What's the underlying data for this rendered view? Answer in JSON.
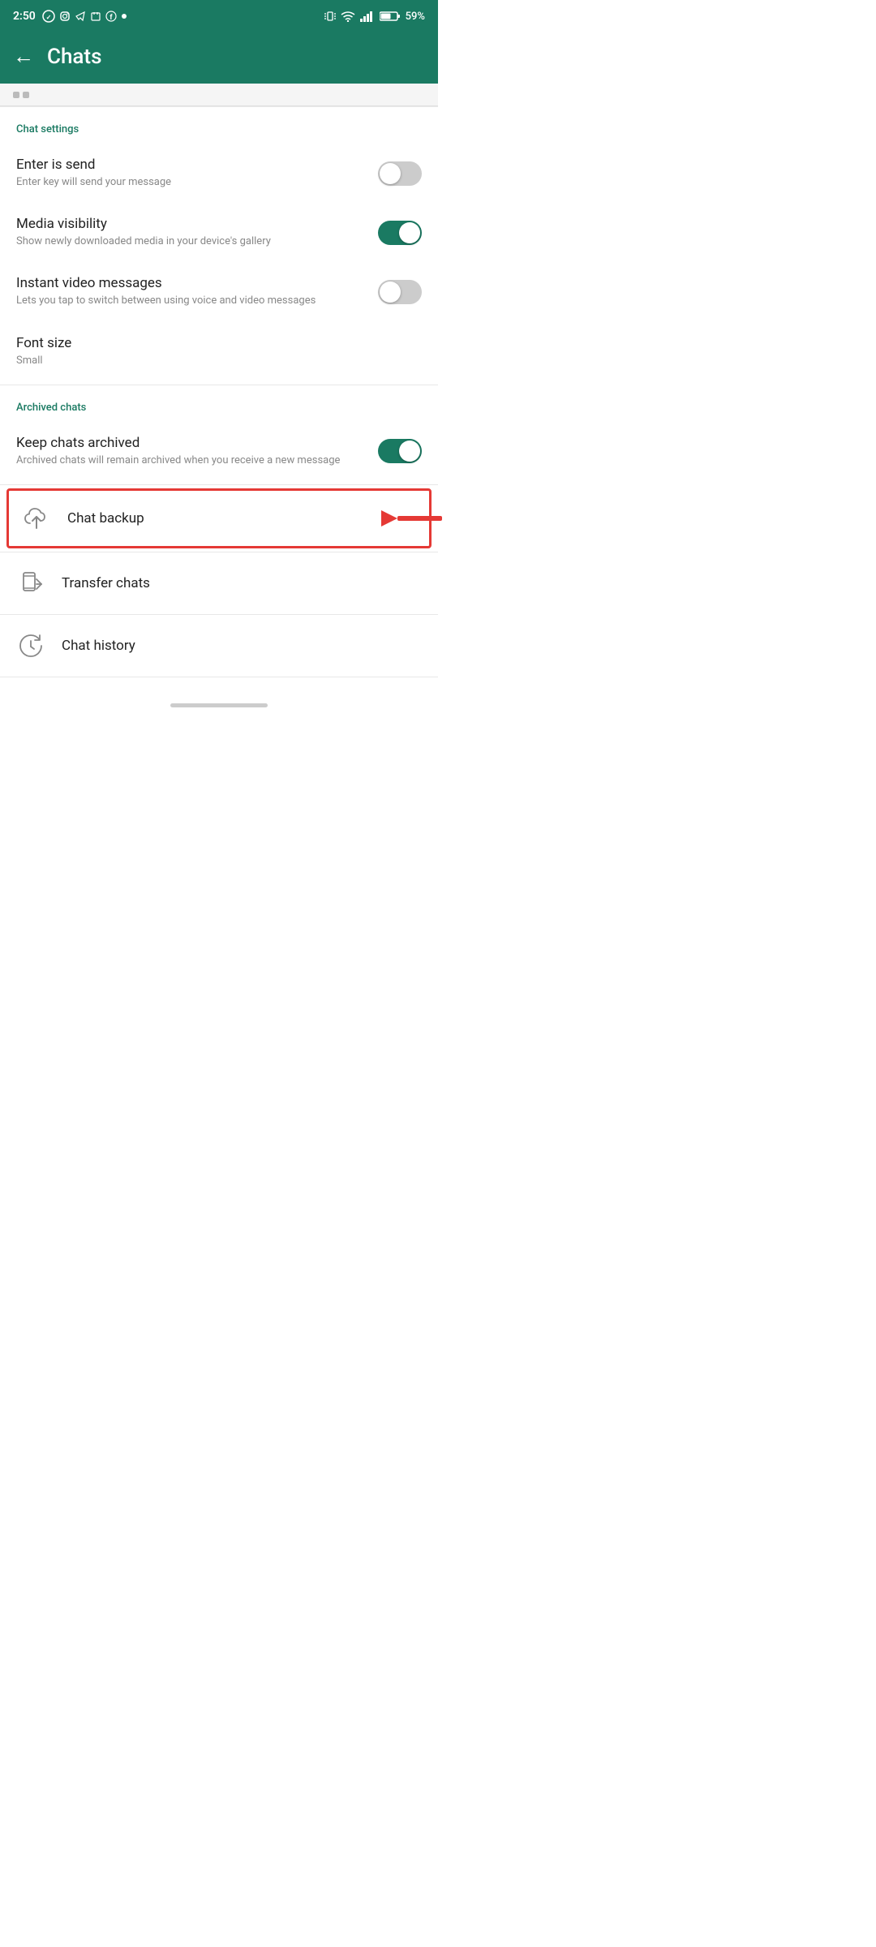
{
  "statusBar": {
    "time": "2:50",
    "battery": "59%"
  },
  "header": {
    "backLabel": "←",
    "title": "Chats"
  },
  "chatSettings": {
    "sectionLabel": "Chat settings",
    "enterIsSend": {
      "title": "Enter is send",
      "subtitle": "Enter key will send your message",
      "enabled": false
    },
    "mediaVisibility": {
      "title": "Media visibility",
      "subtitle": "Show newly downloaded media in your device's gallery",
      "enabled": true
    },
    "instantVideoMessages": {
      "title": "Instant video messages",
      "subtitle": "Lets you tap to switch between using voice and video messages",
      "enabled": false
    },
    "fontSize": {
      "title": "Font size",
      "subtitle": "Small"
    }
  },
  "archivedChats": {
    "sectionLabel": "Archived chats",
    "keepChatsArchived": {
      "title": "Keep chats archived",
      "subtitle": "Archived chats will remain archived when you receive a new message",
      "enabled": true
    }
  },
  "actionRows": {
    "chatBackup": {
      "label": "Chat backup",
      "highlighted": true
    },
    "transferChats": {
      "label": "Transfer chats"
    },
    "chatHistory": {
      "label": "Chat history"
    }
  }
}
